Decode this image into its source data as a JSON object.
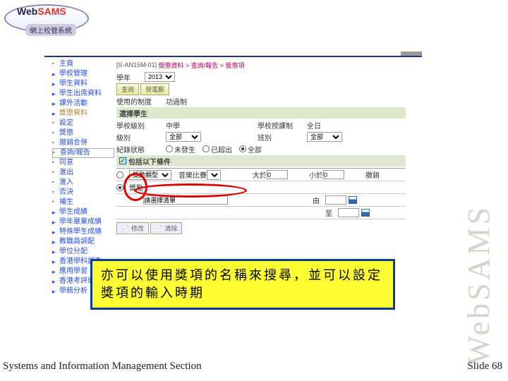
{
  "logo": {
    "text1": "Web",
    "text2": "SAMS",
    "sub": "網上校管系統"
  },
  "sidebar": [
    {
      "label": "主頁",
      "type": "bullet"
    },
    {
      "label": "學校管理",
      "type": "arrow"
    },
    {
      "label": "學生資料",
      "type": "arrow"
    },
    {
      "label": "學生出席資料",
      "type": "arrow"
    },
    {
      "label": "課外活動",
      "type": "arrow"
    },
    {
      "label": "獎懲資料",
      "type": "arrow",
      "redtext": true
    },
    {
      "label": "設定",
      "type": "bullet"
    },
    {
      "label": "獎懲",
      "type": "bullet"
    },
    {
      "label": "撤銷合併",
      "type": "bullet"
    },
    {
      "label": "查詢/報告",
      "type": "bullet",
      "active": true
    },
    {
      "label": "同意",
      "type": "bullet"
    },
    {
      "label": "滙出",
      "type": "bullet"
    },
    {
      "label": "滙入",
      "type": "bullet"
    },
    {
      "label": "否決",
      "type": "bullet"
    },
    {
      "label": "補生",
      "type": "bullet"
    },
    {
      "label": "學生成績",
      "type": "arrow"
    },
    {
      "label": "學年畢業成績",
      "type": "arrow"
    },
    {
      "label": "特殊學生成績",
      "type": "arrow"
    },
    {
      "label": "教職員調配",
      "type": "arrow"
    },
    {
      "label": "學位分配",
      "type": "arrow"
    },
    {
      "label": "香港學科調查",
      "type": "arrow"
    },
    {
      "label": "應用學習",
      "type": "arrow"
    },
    {
      "label": "香港考評局程序",
      "type": "arrow"
    },
    {
      "label": "學務分析",
      "type": "arrow"
    }
  ],
  "breadcrumb": {
    "prefix": "[S-AN15M-01]",
    "path": "獎懲資料 > 查詢/報告 > 獎懲項"
  },
  "year": {
    "label": "學年",
    "value": "2013"
  },
  "buttons": {
    "search": "查詢",
    "sendmail": "發電郵"
  },
  "section": {
    "system": "使用的制度",
    "system_val": "功過制",
    "select_student": "選擇學生"
  },
  "fields": {
    "level_lbl": "學校級別",
    "level_val": "中學",
    "session_lbl": "學校授課制",
    "session_val": "全日",
    "class_lbl": "級別",
    "class_val": "全部",
    "classno_lbl": "班別",
    "classno_val": "全部",
    "recstate_lbl": "紀錄狀態",
    "recstate_opts": [
      "未發生",
      "已超出",
      "全部"
    ],
    "include_lbl": "包括以下條件"
  },
  "table": {
    "row1": {
      "type_lbl": "獎勵類型",
      "name_lbl": "音樂比賽",
      "max_lbl": "大於",
      "max_val": "0",
      "min_lbl": "小於",
      "min_val": "0",
      "undo_lbl": "撤銷"
    },
    "row2": {
      "reward_lbl": "獎勵",
      "name_lbl": "請選擇清單",
      "by_lbl": "由",
      "to_lbl": "至"
    }
  },
  "footer_buttons": {
    "modify": "修改",
    "cancel": "清除"
  },
  "annotation": "亦可以使用獎項的名稱來搜尋，並可以設定獎項的輸入時期",
  "watermark": "WebSAMS",
  "footer": {
    "left": "Systems and Information Management Section",
    "right_label": "Slide",
    "right_num": "68"
  }
}
